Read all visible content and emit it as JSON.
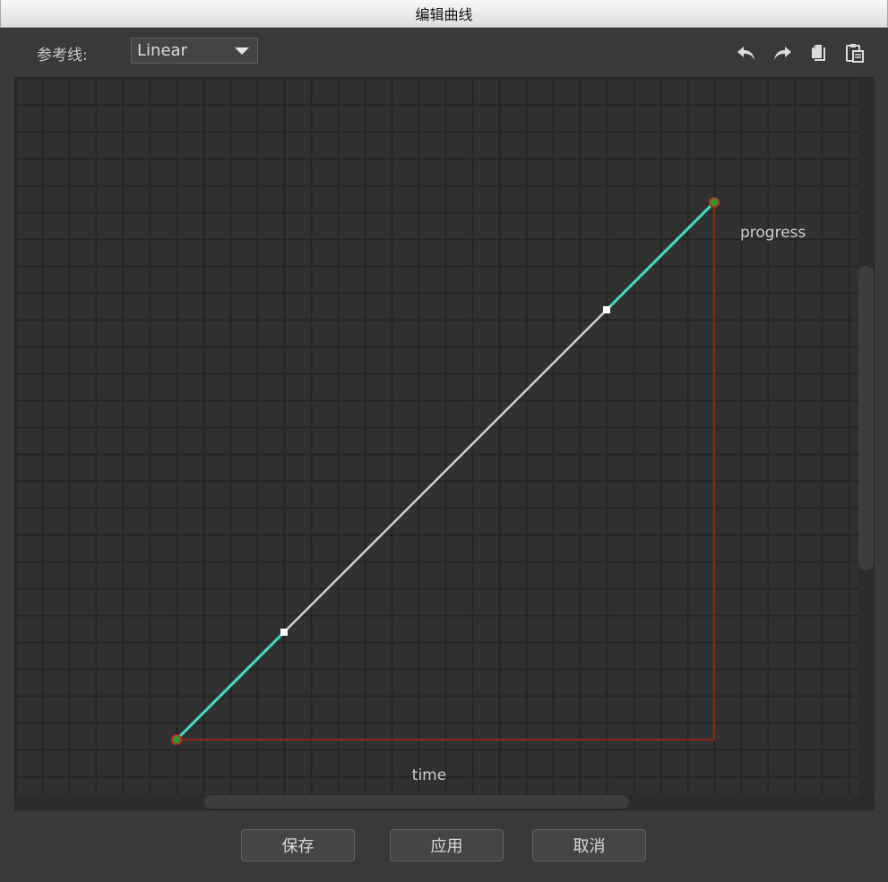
{
  "window": {
    "title": "编辑曲线"
  },
  "toolbar": {
    "reference_label": "参考线:",
    "reference_value": "Linear",
    "icons": [
      "undo-icon",
      "redo-icon",
      "copy-icon",
      "paste-icon"
    ]
  },
  "editor": {
    "x_label": "time",
    "y_label": "progress",
    "curve_type": "linear",
    "start_point": {
      "time": 0,
      "progress": 0
    },
    "end_point": {
      "time": 1,
      "progress": 1
    },
    "control_points": [
      {
        "time": 0.2,
        "progress": 0.2
      },
      {
        "time": 0.8,
        "progress": 0.8
      }
    ],
    "colors": {
      "curve": "#d0d0d0",
      "tangent": "#3fe0c6",
      "axis": "#8a2a10",
      "endpoint_fill": "#2e9a2e",
      "endpoint_ring": "#b03a1a",
      "handle": "#ffffff",
      "grid": "#252525",
      "background": "#313131"
    }
  },
  "buttons": {
    "save": "保存",
    "apply": "应用",
    "cancel": "取消"
  }
}
